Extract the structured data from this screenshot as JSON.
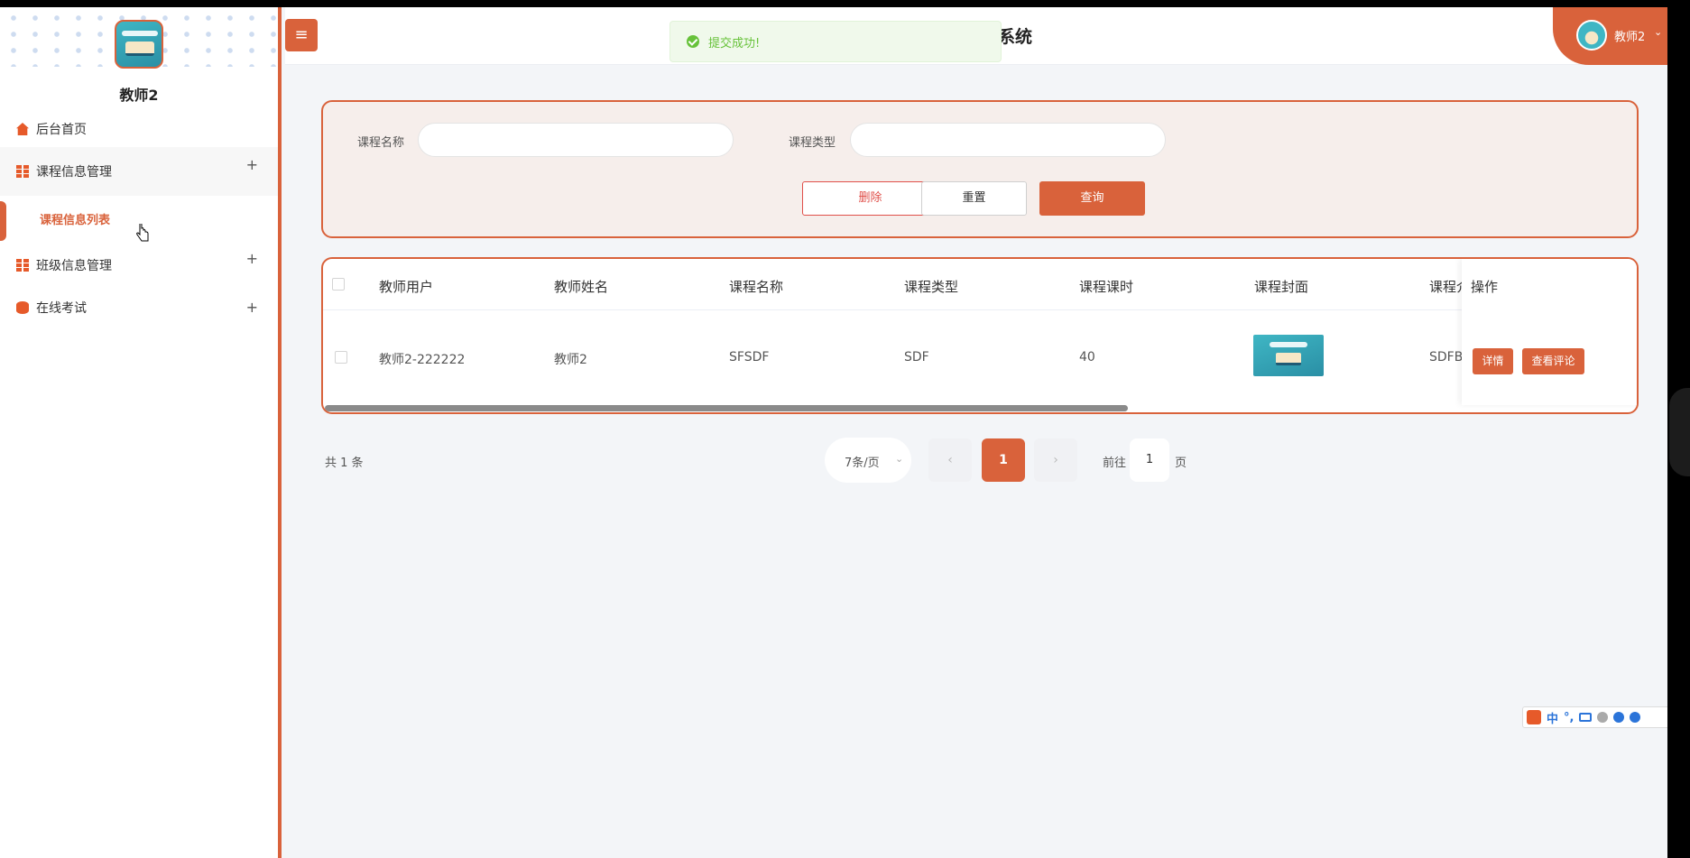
{
  "sidebar": {
    "username": "教师2",
    "items": [
      {
        "label": "后台首页",
        "icon": "home-icon"
      },
      {
        "label": "课程信息管理",
        "icon": "grid-icon",
        "toggle": "+"
      },
      {
        "label": "课程信息列表",
        "active": true
      },
      {
        "label": "班级信息管理",
        "icon": "grid-icon",
        "toggle": "+"
      },
      {
        "label": "在线考试",
        "icon": "database-icon",
        "toggle": "+"
      }
    ]
  },
  "header": {
    "menu_toggle": "≡",
    "title_fragment": "系统",
    "toast": "提交成功!",
    "user_name": "教师2",
    "user_caret": "⌄"
  },
  "search": {
    "course_name_label": "课程名称",
    "course_name_value": "",
    "course_type_label": "课程类型",
    "course_type_value": "",
    "delete_label": "删除",
    "reset_label": "重置",
    "query_label": "查询"
  },
  "table": {
    "headers": [
      "教师用户",
      "教师姓名",
      "课程名称",
      "课程类型",
      "课程课时",
      "课程封面",
      "课程介",
      "操作"
    ],
    "rows": [
      {
        "teacher_user": "教师2-222222",
        "teacher_name": "教师2",
        "course_name": "SFSDF",
        "course_type": "SDF",
        "course_hours": "40",
        "course_intro": "SDFBK",
        "detail_label": "详情",
        "comments_label": "查看评论"
      }
    ]
  },
  "pagination": {
    "total": "共 1 条",
    "page_size": "7条/页",
    "prev": "‹",
    "current_page": "1",
    "next": "›",
    "goto_prefix": "前往",
    "goto_value": "1",
    "goto_suffix": "页"
  },
  "ime": {
    "mode": "中",
    "punct": "°,"
  },
  "colors": {
    "accent": "#d9623b",
    "toast_green": "#67c23a"
  }
}
